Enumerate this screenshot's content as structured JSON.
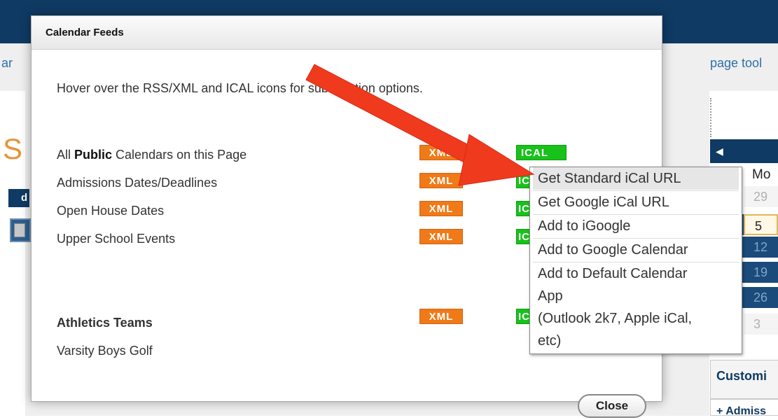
{
  "background": {
    "left_fragment": "ar",
    "right_link": "page tool",
    "big_letter": "S",
    "nav_chip": "d",
    "calendar_header_arrow": "◀",
    "calendar_day_header": "Mo",
    "calendar_cells": [
      "29",
      "5",
      "12",
      "19",
      "26",
      "3"
    ],
    "customize_label": "Customi",
    "admissions_link": "+ Admiss"
  },
  "modal": {
    "title": "Calendar Feeds",
    "instructions": "Hover over the RSS/XML and ICAL icons for subscription options.",
    "rows": [
      {
        "pre": "All ",
        "bold": "Public",
        "post": " Calendars on this Page"
      },
      {
        "label": "Admissions Dates/Deadlines"
      },
      {
        "label": "Open House Dates"
      },
      {
        "label": "Upper School Events"
      }
    ],
    "athletics_heading": "Athletics Teams",
    "athletics_rows": [
      {
        "label": "Varsity Boys Golf"
      }
    ],
    "xml_label": "XML",
    "ical_label": "ICAL",
    "close_label": "Close"
  },
  "popup_menu": {
    "items": [
      "Get Standard iCal URL",
      "Get Google iCal URL",
      "Add to iGoogle",
      "Add to Google Calendar",
      "Add to Default Calendar",
      "App",
      "(Outlook 2k7, Apple iCal,",
      "etc)"
    ],
    "highlighted_index": 0
  },
  "colors": {
    "navy": "#0f3a63",
    "xml_orange": "#f07a18",
    "ical_green": "#18c21a",
    "arrow_red": "#f03a1e"
  }
}
